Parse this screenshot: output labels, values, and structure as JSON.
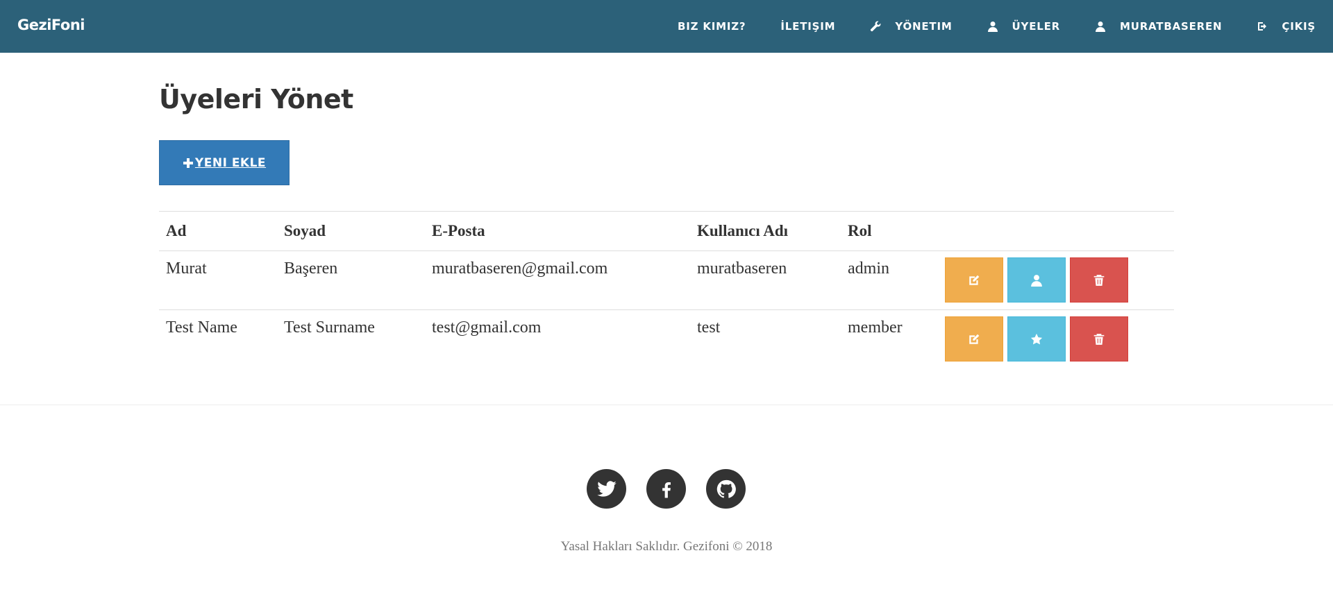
{
  "brand": "GeziFoni",
  "nav": {
    "about": "BIZ KIMIZ?",
    "contact": "İLETIŞIM",
    "admin": "YÖNETIM",
    "members": "ÜYELER",
    "user": "MURATBASEREN",
    "logout": "ÇIKIŞ"
  },
  "page": {
    "title": "Üyeleri Yönet",
    "add_button": " YENI EKLE"
  },
  "table": {
    "headers": [
      "Ad",
      "Soyad",
      "E-Posta",
      "Kullanıcı Adı",
      "Rol"
    ],
    "rows": [
      {
        "first": "Murat",
        "last": "Başeren",
        "email": "muratbaseren@gmail.com",
        "username": "muratbaseren",
        "role": "admin",
        "role_icon": "user-icon"
      },
      {
        "first": "Test Name",
        "last": "Test Surname",
        "email": "test@gmail.com",
        "username": "test",
        "role": "member",
        "role_icon": "star-icon"
      }
    ]
  },
  "footer": {
    "social": [
      "twitter-icon",
      "facebook-icon",
      "github-icon"
    ],
    "copyright": "Yasal Hakları Saklıdır. Gezifoni © 2018"
  },
  "colors": {
    "navbar": "#2c6179",
    "primary": "#337ab7",
    "warning": "#f0ad4e",
    "info": "#5bc0de",
    "danger": "#d9534f"
  }
}
